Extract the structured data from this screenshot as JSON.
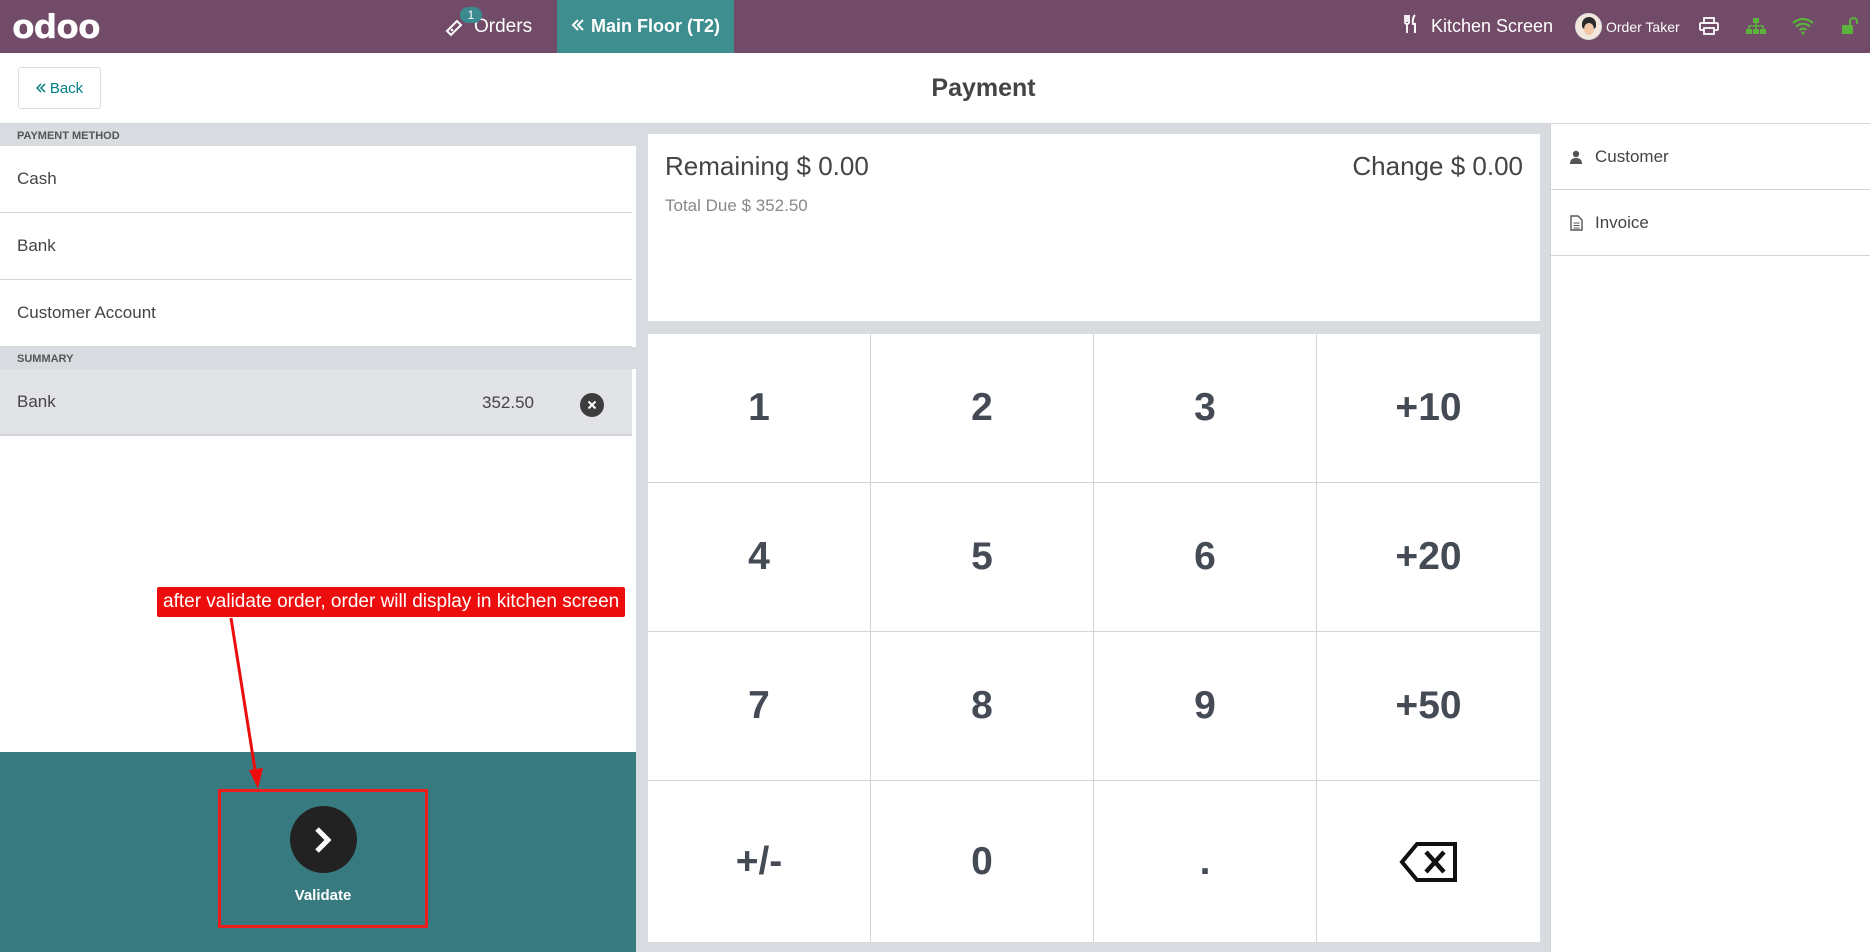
{
  "navbar": {
    "logo": "odoo",
    "orders_label": "Orders",
    "orders_badge": "1",
    "floor_label": "Main Floor  (T2)",
    "kitchen_label": "Kitchen Screen",
    "user_label": "Order Taker",
    "colors": {
      "background": "#714b67",
      "floor_tab": "#3e8e8f",
      "status_ok": "#5bb33c"
    }
  },
  "control": {
    "back_label": "Back",
    "title": "Payment"
  },
  "payment_methods": {
    "header": "PAYMENT METHOD",
    "items": [
      {
        "label": "Cash"
      },
      {
        "label": "Bank"
      },
      {
        "label": "Customer Account"
      }
    ]
  },
  "summary": {
    "header": "SUMMARY",
    "lines": [
      {
        "method": "Bank",
        "amount": "352.50"
      }
    ]
  },
  "status": {
    "remaining_label": "Remaining",
    "remaining_value": "$ 0.00",
    "change_label": "Change",
    "change_value": "$ 0.00",
    "total_due_label": "Total Due",
    "total_due_value": "$ 352.50"
  },
  "numpad": {
    "keys": [
      "1",
      "2",
      "3",
      "+10",
      "4",
      "5",
      "6",
      "+20",
      "7",
      "8",
      "9",
      "+50",
      "+/-",
      "0",
      ".",
      "backspace"
    ]
  },
  "right_panel": {
    "customer_label": "Customer",
    "invoice_label": "Invoice"
  },
  "validate": {
    "label": "Validate",
    "colors": {
      "area": "#377a7f",
      "highlight": "#ee1c1c"
    }
  },
  "annotation": {
    "text": "after validate order, order will display in kitchen screen"
  }
}
